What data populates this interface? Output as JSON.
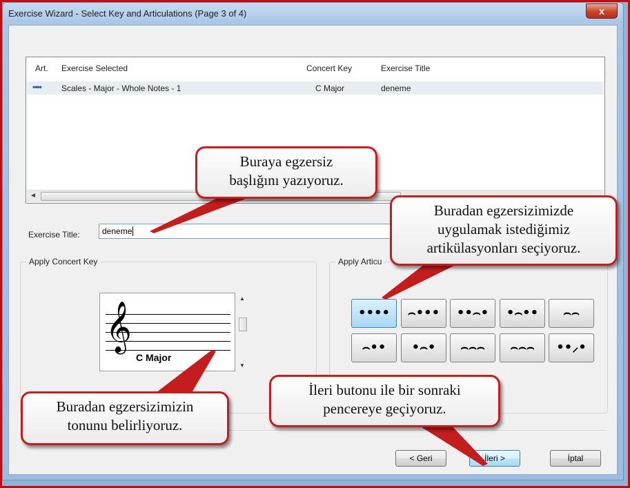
{
  "window": {
    "title": "Exercise Wizard - Select Key and Articulations (Page 3 of 4)",
    "close_glyph": "x"
  },
  "list": {
    "headers": {
      "art": "Art.",
      "exercise": "Exercise Selected",
      "key": "Concert Key",
      "title": "Exercise Title"
    },
    "rows": [
      {
        "art": "••••",
        "exercise": "Scales  - Major  - Whole Notes - 1",
        "key": "C Major",
        "title": "deneme"
      }
    ],
    "scroll_left_glyph": "◄",
    "scroll_grip": "|||"
  },
  "exercise_title": {
    "label": "Exercise Title:",
    "value": "deneme"
  },
  "concert_key": {
    "group_title": "Apply Concert Key",
    "clef_glyph": "𝄞",
    "key_name": "C Major",
    "scroll_up": "▲",
    "scroll_down": "▼"
  },
  "articulations": {
    "group_title": "Apply Articu",
    "selected_index": 0,
    "buttons": [
      "••••",
      "⌢•••",
      "••⌢•",
      "•⌢••",
      "⌢⌢",
      "⌢••",
      "•⌢•",
      "⌢⌢⌢",
      "⌢⌢⌢",
      "••⸝•"
    ]
  },
  "buttons": {
    "back": "< Geri",
    "next": "İleri >",
    "cancel": "İptal"
  },
  "callouts": {
    "title_hint_line1": "Buraya egzersiz",
    "title_hint_line2": "başlığını yazıyoruz.",
    "artic_hint_line1": "Buradan egzersizimizde",
    "artic_hint_line2": "uygulamak istediğimiz",
    "artic_hint_line3": "artikülasyonları seçiyoruz.",
    "key_hint_line1": "Buradan egzersizimizin",
    "key_hint_line2": "tonunu belirliyoruz.",
    "next_hint_line1": "İleri butonu ile bir sonraki",
    "next_hint_line2": "pencereye geçiyoruz."
  },
  "colors": {
    "callout_border": "#c41d1d",
    "frame": "#c00d13",
    "selected_button": "#a7d8f4"
  }
}
